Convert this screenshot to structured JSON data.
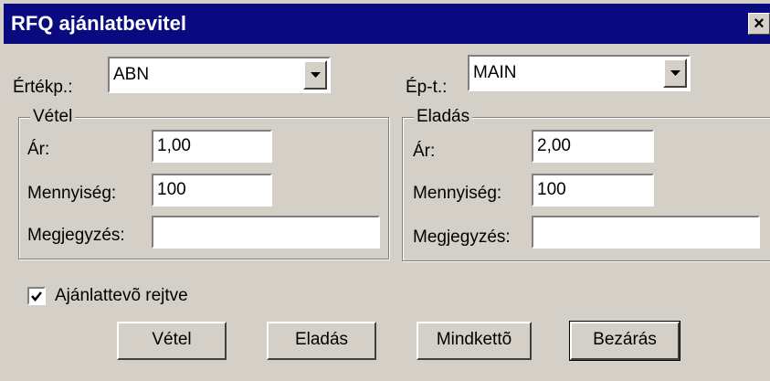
{
  "window": {
    "title": "RFQ ajánlatbevitel",
    "close_label": "×"
  },
  "header": {
    "ertekp_label": "Értékp.:",
    "ertekp_value": "ABN",
    "ept_label": "Ép-t.:",
    "ept_value": "MAIN"
  },
  "vetel": {
    "title": "Vétel",
    "ar_label": "Ár:",
    "ar_value": "1,00",
    "mennyiseg_label": "Mennyiség:",
    "mennyiseg_value": "100",
    "megjegyzes_label": "Megjegyzés:",
    "megjegyzes_value": ""
  },
  "eladas": {
    "title": "Eladás",
    "ar_label": "Ár:",
    "ar_value": "2,00",
    "mennyiseg_label": "Mennyiség:",
    "mennyiseg_value": "100",
    "megjegyzes_label": "Megjegyzés:",
    "megjegyzes_value": ""
  },
  "checkbox": {
    "label": "Ajánlattevõ rejtve",
    "checked": true
  },
  "buttons": {
    "vetel": "Vétel",
    "eladas": "Eladás",
    "mindketto": "Mindkettõ",
    "bezaras": "Bezárás"
  }
}
